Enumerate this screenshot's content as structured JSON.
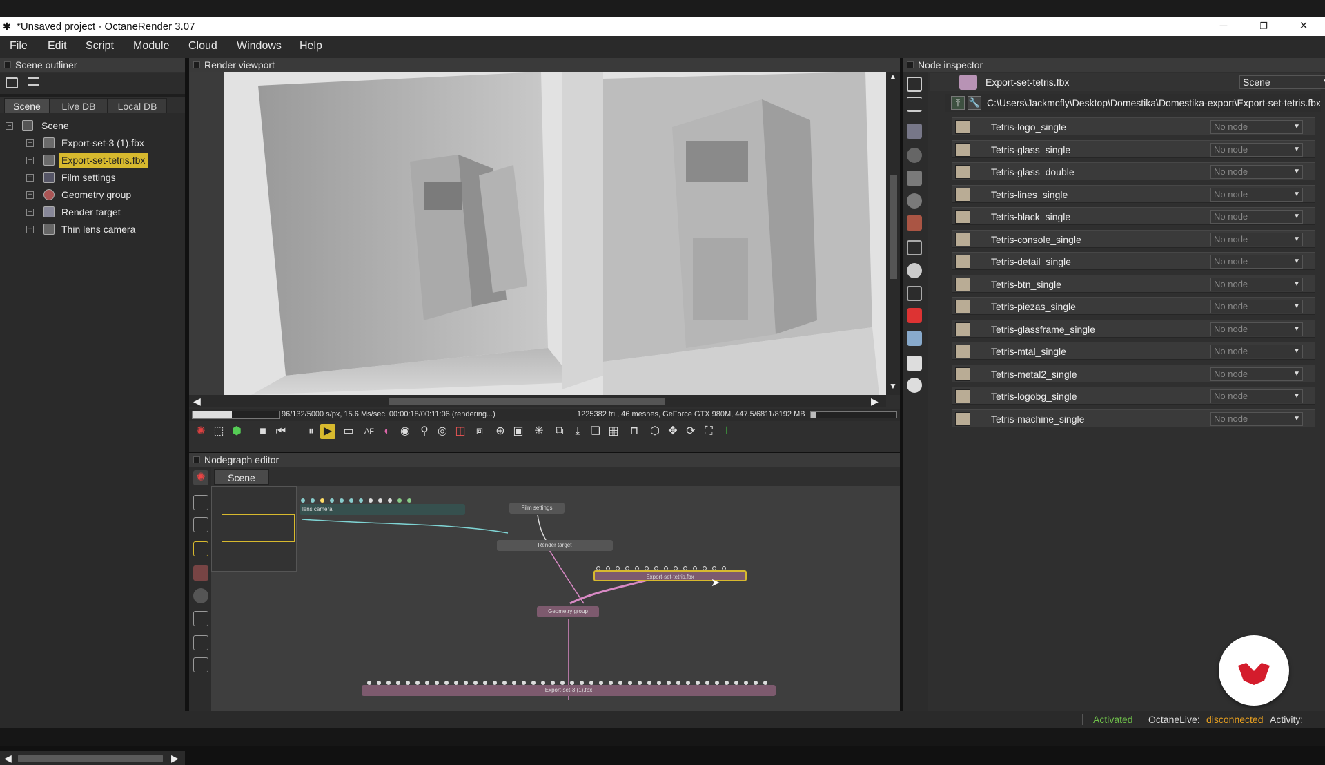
{
  "window": {
    "title": "*Unsaved project - OctaneRender 3.07",
    "minimize": "─",
    "maximize": "❐",
    "close": "✕"
  },
  "menu": [
    "File",
    "Edit",
    "Script",
    "Module",
    "Cloud",
    "Windows",
    "Help"
  ],
  "scene_outliner": {
    "title": "Scene outliner",
    "tabs": [
      "Scene",
      "Live DB",
      "Local DB"
    ],
    "root": "Scene",
    "items": [
      {
        "label": "Export-set-3 (1).fbx",
        "selected": false
      },
      {
        "label": "Export-set-tetris.fbx",
        "selected": true
      },
      {
        "label": "Film settings",
        "selected": false
      },
      {
        "label": "Geometry group",
        "selected": false
      },
      {
        "label": "Render target",
        "selected": false
      },
      {
        "label": "Thin lens camera",
        "selected": false
      }
    ]
  },
  "render_viewport": {
    "title": "Render viewport",
    "progress_fraction": 0.45,
    "status_left": "96/132/5000 s/px, 15.6 Ms/sec, 00:00:18/00:11:06 (rendering...)",
    "status_right": "1225382 tri., 46 meshes, GeForce GTX 980M, 447.5/6811/8192 MB"
  },
  "nodegraph": {
    "title": "Nodegraph editor",
    "tab": "Scene",
    "nodes": {
      "camera": "lens camera",
      "film": "Film settings",
      "render_target": "Render target",
      "tetris": "Export-set-tetris.fbx",
      "geometry": "Geometry group",
      "export3": "Export-set-3 (1).fbx"
    }
  },
  "node_inspector": {
    "title": "Node inspector",
    "node_name": "Export-set-tetris.fbx",
    "scope": "Scene",
    "path": "C:\\Users\\Jackmcfly\\Desktop\\Domestika\\Domestika-export\\Export-set-tetris.fbx",
    "no_node": "No node",
    "rows": [
      "Tetris-logo_single",
      "Tetris-glass_single",
      "Tetris-glass_double",
      "Tetris-lines_single",
      "Tetris-black_single",
      "Tetris-console_single",
      "Tetris-detail_single",
      "Tetris-btn_single",
      "Tetris-piezas_single",
      "Tetris-glassframe_single",
      "Tetris-mtal_single",
      "Tetris-metal2_single",
      "Tetris-logobg_single",
      "Tetris-machine_single"
    ]
  },
  "status": {
    "activated": "Activated",
    "octanelive_label": "OctaneLive:",
    "octanelive_value": "disconnected",
    "activity_label": "Activity:"
  },
  "colors": {
    "selection": "#d7b92e",
    "activated": "#6fc04a",
    "disconnected": "#e8a020",
    "brand": "#d41c2c"
  }
}
